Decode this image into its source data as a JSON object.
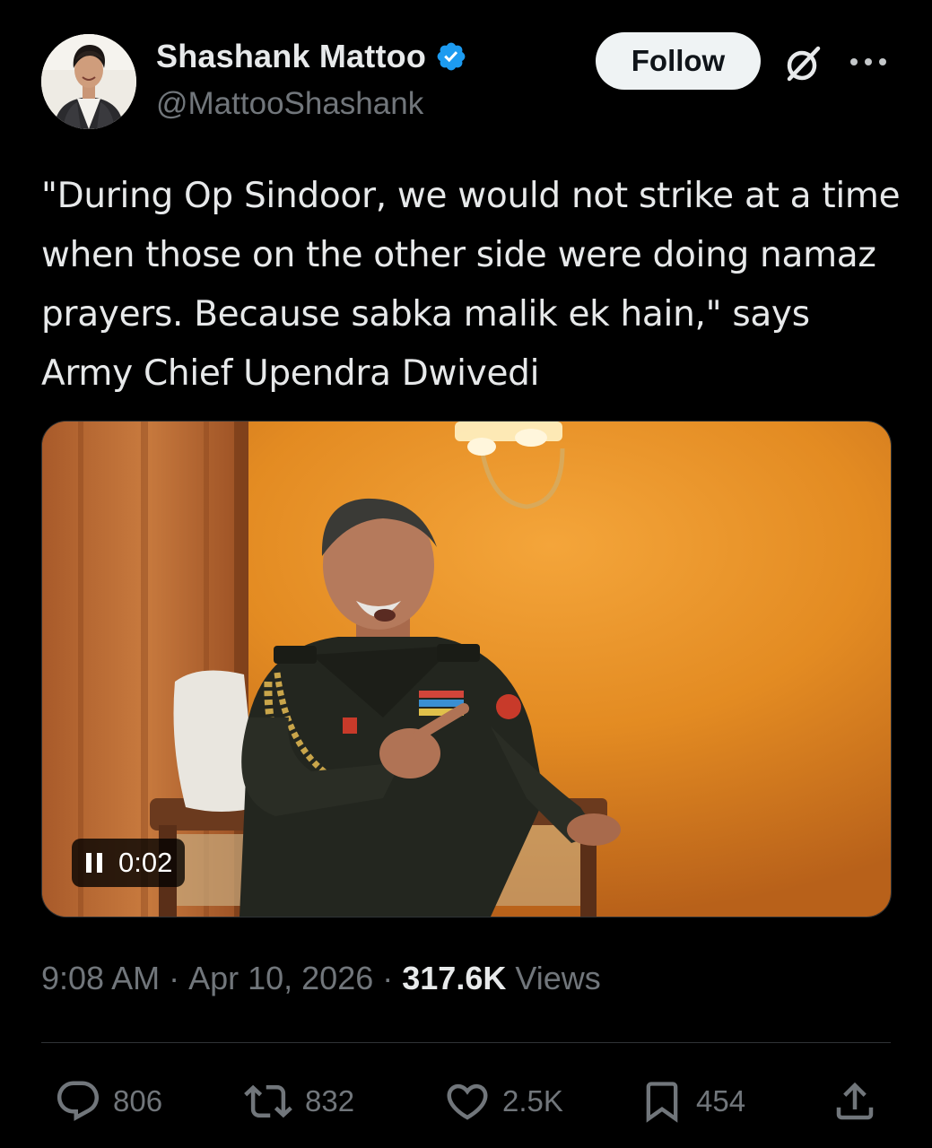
{
  "author": {
    "display_name": "Shashank Mattoo",
    "handle": "@MattooShashank",
    "verified": true,
    "avatar": "avatar-photo"
  },
  "header": {
    "follow_label": "Follow",
    "grok_icon": "grok-icon",
    "more_icon": "more-icon"
  },
  "tweet": {
    "text": "\"During Op Sindoor, we would not strike at a time when those on the other side were doing namaz prayers. Because sabka malik ek hain,\" says Army Chief Upendra Dwivedi"
  },
  "media": {
    "type": "video",
    "elapsed": "0:02",
    "control_icon": "pause-icon"
  },
  "meta": {
    "time": "9:08 AM",
    "separator": "·",
    "date": "Apr 10, 2026",
    "views_count": "317.6K",
    "views_label": "Views"
  },
  "actions": {
    "reply_count": "806",
    "repost_count": "832",
    "like_count": "2.5K",
    "bookmark_count": "454"
  },
  "colors": {
    "background": "#000000",
    "text": "#e7e9ea",
    "secondary_text": "#71767b",
    "verified_badge": "#1d9bf0",
    "follow_button_bg": "#eff3f4"
  }
}
